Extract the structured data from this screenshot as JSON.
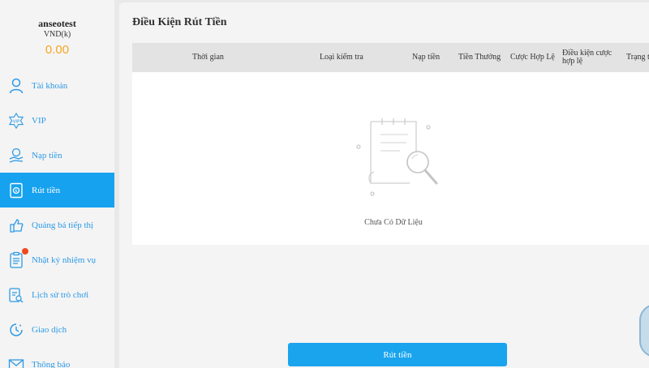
{
  "user": {
    "name": "anseotest",
    "currency": "VND(k)",
    "balance": "0.00"
  },
  "sidebar": {
    "items": [
      {
        "label": "Tài khoản",
        "icon": "user-icon",
        "active": false
      },
      {
        "label": "VIP",
        "icon": "vip-icon",
        "active": false
      },
      {
        "label": "Nạp tiền",
        "icon": "deposit-icon",
        "active": false
      },
      {
        "label": "Rút tiền",
        "icon": "withdraw-icon",
        "active": true
      },
      {
        "label": "Quảng bá tiếp thị",
        "icon": "promotion-icon",
        "active": false
      },
      {
        "label": "Nhật ký nhiệm vụ",
        "icon": "task-log-icon",
        "active": false,
        "badge": true
      },
      {
        "label": "Lịch sử trò chơi",
        "icon": "game-history-icon",
        "active": false
      },
      {
        "label": "Giao dịch",
        "icon": "transaction-icon",
        "active": false
      },
      {
        "label": "Thông báo",
        "icon": "mail-icon",
        "active": false
      }
    ]
  },
  "main": {
    "title": "Điều Kiện Rút Tiền",
    "table": {
      "columns": [
        "Thời gian",
        "Loại kiểm tra",
        "Nạp tiền",
        "Tiền Thưởng",
        "Cược Hợp Lệ",
        "Điều kiện cược hợp lệ",
        "Trạng thái"
      ],
      "empty_text": "Chưa Có Dữ Liệu"
    },
    "withdraw_button": "Rút tiền"
  },
  "colors": {
    "accent": "#17a2f0",
    "balance": "#f5a623",
    "badge": "#f0491f"
  }
}
